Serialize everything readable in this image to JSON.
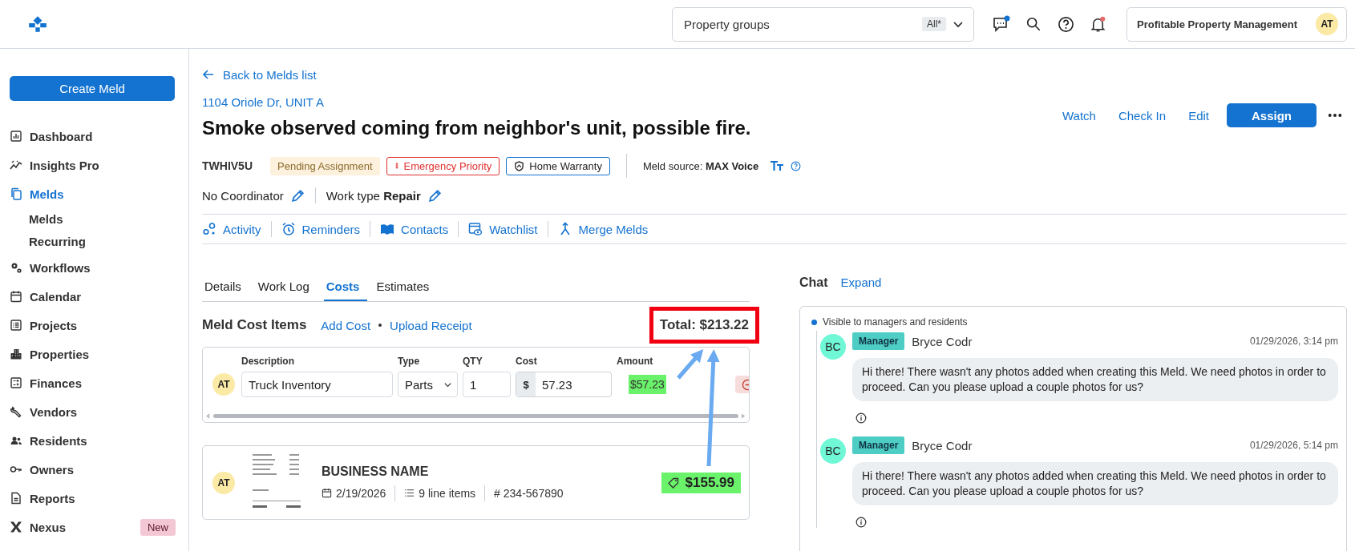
{
  "topbar": {
    "property_groups": {
      "label": "Property groups",
      "badge": "All*"
    },
    "chat_unread": true,
    "notifications_unread": true,
    "account": {
      "name": "Profitable Property Management",
      "initials": "AT"
    }
  },
  "sidebar": {
    "create_button": "Create Meld",
    "items": [
      {
        "label": "Dashboard",
        "selected": false
      },
      {
        "label": "Insights Pro",
        "selected": false
      },
      {
        "label": "Melds",
        "selected": true,
        "children": [
          {
            "label": "Melds",
            "selected": false
          },
          {
            "label": "Recurring",
            "selected": false
          }
        ]
      },
      {
        "label": "Workflows",
        "selected": false
      },
      {
        "label": "Calendar",
        "selected": false
      },
      {
        "label": "Projects",
        "selected": false
      },
      {
        "label": "Properties",
        "selected": false
      },
      {
        "label": "Finances",
        "selected": false
      },
      {
        "label": "Vendors",
        "selected": false
      },
      {
        "label": "Residents",
        "selected": false
      },
      {
        "label": "Owners",
        "selected": false
      },
      {
        "label": "Reports",
        "selected": false
      },
      {
        "label": "Nexus",
        "selected": false,
        "badge": "New"
      }
    ]
  },
  "meld": {
    "back_link": "Back to Melds list",
    "address": "1104 Oriole Dr, UNIT A",
    "title": "Smoke observed coming from neighbor's unit, possible fire.",
    "actions": [
      {
        "label": "Watch",
        "kind": "link"
      },
      {
        "label": "Check In",
        "kind": "link"
      },
      {
        "label": "Edit",
        "kind": "link"
      },
      {
        "label": "Assign",
        "kind": "primary"
      }
    ],
    "id": "TWHIV5U",
    "badges": [
      {
        "text": "Pending Assignment",
        "kind": "status"
      },
      {
        "text": "Emergency Priority",
        "kind": "priority"
      },
      {
        "text": "Home Warranty",
        "kind": "warranty"
      }
    ],
    "meld_source": "Meld source: **MAX Voice**",
    "coordinator": "No Coordinator",
    "work_type": "Work type **Repair**",
    "links": [
      "Activity",
      "Reminders",
      "Contacts",
      "Watchlist",
      "Merge Melds"
    ]
  },
  "tabs": [
    {
      "label": "Details",
      "selected": false
    },
    {
      "label": "Work Log",
      "selected": false
    },
    {
      "label": "Costs",
      "selected": true
    },
    {
      "label": "Estimates",
      "selected": false
    }
  ],
  "costs": {
    "heading": "Meld Cost Items",
    "links": [
      "Add Cost",
      "Upload Receipt"
    ],
    "total": "Total: $213.22",
    "total_framed": true,
    "columns": [
      "Description",
      "Type",
      "QTY",
      "Cost",
      "Amount"
    ],
    "items": [
      {
        "initials": "AT",
        "description": "Truck Inventory",
        "type": "Parts",
        "qty": "1",
        "currency": "$",
        "cost": "57.23",
        "amount": "$57.23",
        "highlighted": true
      }
    ],
    "receipts": [
      {
        "initials": "AT",
        "business": "BUSINESS NAME",
        "date": "2/19/2026",
        "line_items": "9 line items",
        "number": "# 234-567890",
        "amount": "$155.99",
        "highlighted": true
      }
    ]
  },
  "chat": {
    "title": "Chat",
    "expand": "Expand",
    "visibility": "Visible to managers and residents",
    "messages": [
      {
        "initials": "BC",
        "role": "Manager",
        "author": "Bryce Codr",
        "time": "01/29/2026, 3:14 pm",
        "text": "Hi there! There wasn't any photos added when creating this Meld. We need photos in order to proceed. Can you please upload a couple photos for us?"
      },
      {
        "initials": "BC",
        "role": "Manager",
        "author": "Bryce Codr",
        "time": "01/29/2026, 5:14 pm",
        "text": "Hi there! There wasn't any photos added when creating this Meld. We need photos in order to proceed. Can you please upload a couple photos for us?"
      }
    ]
  }
}
